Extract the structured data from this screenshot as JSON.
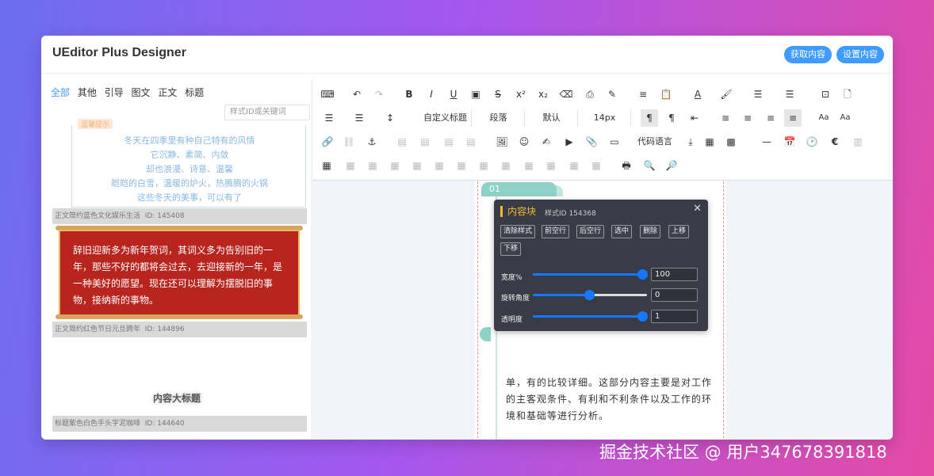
{
  "app": {
    "title": "UEditor Plus Designer",
    "get_content": "获取内容",
    "set_content": "设置内容"
  },
  "sidebar": {
    "categories": [
      {
        "label": "全部",
        "active": true
      },
      {
        "label": "其他"
      },
      {
        "label": "引导"
      },
      {
        "label": "图文"
      },
      {
        "label": "正文"
      },
      {
        "label": "标题"
      }
    ],
    "search_placeholder": "样式ID或关键词",
    "templates": [
      {
        "tag": "温馨提示",
        "lines": [
          "冬天在四季里有种自己特有的风情",
          "它沉静、素简、内敛",
          "却也浪漫、诗意、温馨",
          "皑皑的白雪，温暖的炉火，热腾腾的火锅",
          "这些冬天的美事，可以有了"
        ],
        "caption": "正文简约蓝色文化娱乐生活",
        "id": "ID: 145408"
      },
      {
        "text": "辞旧迎新多为新年贺词，其词义多为告别旧的一年，那些不好的都将会过去，去迎接新的一年，是一种美好的愿望。现在还可以理解为摆脱旧的事物，接纳新的事物。",
        "caption": "正文简约红色节日元旦跨年",
        "id": "ID: 144896"
      },
      {
        "title": "内容大标题",
        "caption": "标题紫色白色手头字泥咖啡",
        "id": "ID: 144640"
      },
      {
        "number": "01"
      }
    ]
  },
  "toolbar": {
    "row1": [
      "keyboard-icon",
      "undo-icon",
      "redo-icon",
      "bold-icon",
      "italic-icon",
      "underline-icon",
      "text-border-icon",
      "strikethrough-icon",
      "superscript-icon",
      "subscript-icon",
      "eraser-icon",
      "format-match-icon",
      "auto-format-icon",
      "paste-plain-icon",
      "font-color-icon",
      "highlight-color-icon",
      "ordered-list-icon",
      "unordered-list-icon",
      "select-all-icon",
      "clear-doc-icon"
    ],
    "custom_title": "自定义标题",
    "paragraph": "段落",
    "font": "默认",
    "font_size": "14px",
    "code_language": "代码语言"
  },
  "doc": {
    "badge": "01",
    "text": "单，有的比较详细。这部分内容主要是对工作的主客观条件、有利和不利条件以及工作的环境和基础等进行分析。"
  },
  "panel": {
    "title": "内容块",
    "style_id": "样式ID 154368",
    "buttons": [
      "清除样式",
      "前空行",
      "后空行",
      "选中",
      "删除",
      "上移",
      "下移"
    ],
    "sliders": [
      {
        "label": "宽度%",
        "value": "100",
        "percent": 100
      },
      {
        "label": "旋转角度",
        "value": "0",
        "percent": 50
      },
      {
        "label": "透明度",
        "value": "1",
        "percent": 100
      }
    ]
  },
  "watermark": "掘金技术社区 @ 用户347678391818",
  "colors": {
    "accent": "#3f9bff",
    "teal": "#8ed1c7",
    "scroll_red": "#b8241e",
    "panel_bg": "#393c46",
    "slider": "#1677ff"
  }
}
